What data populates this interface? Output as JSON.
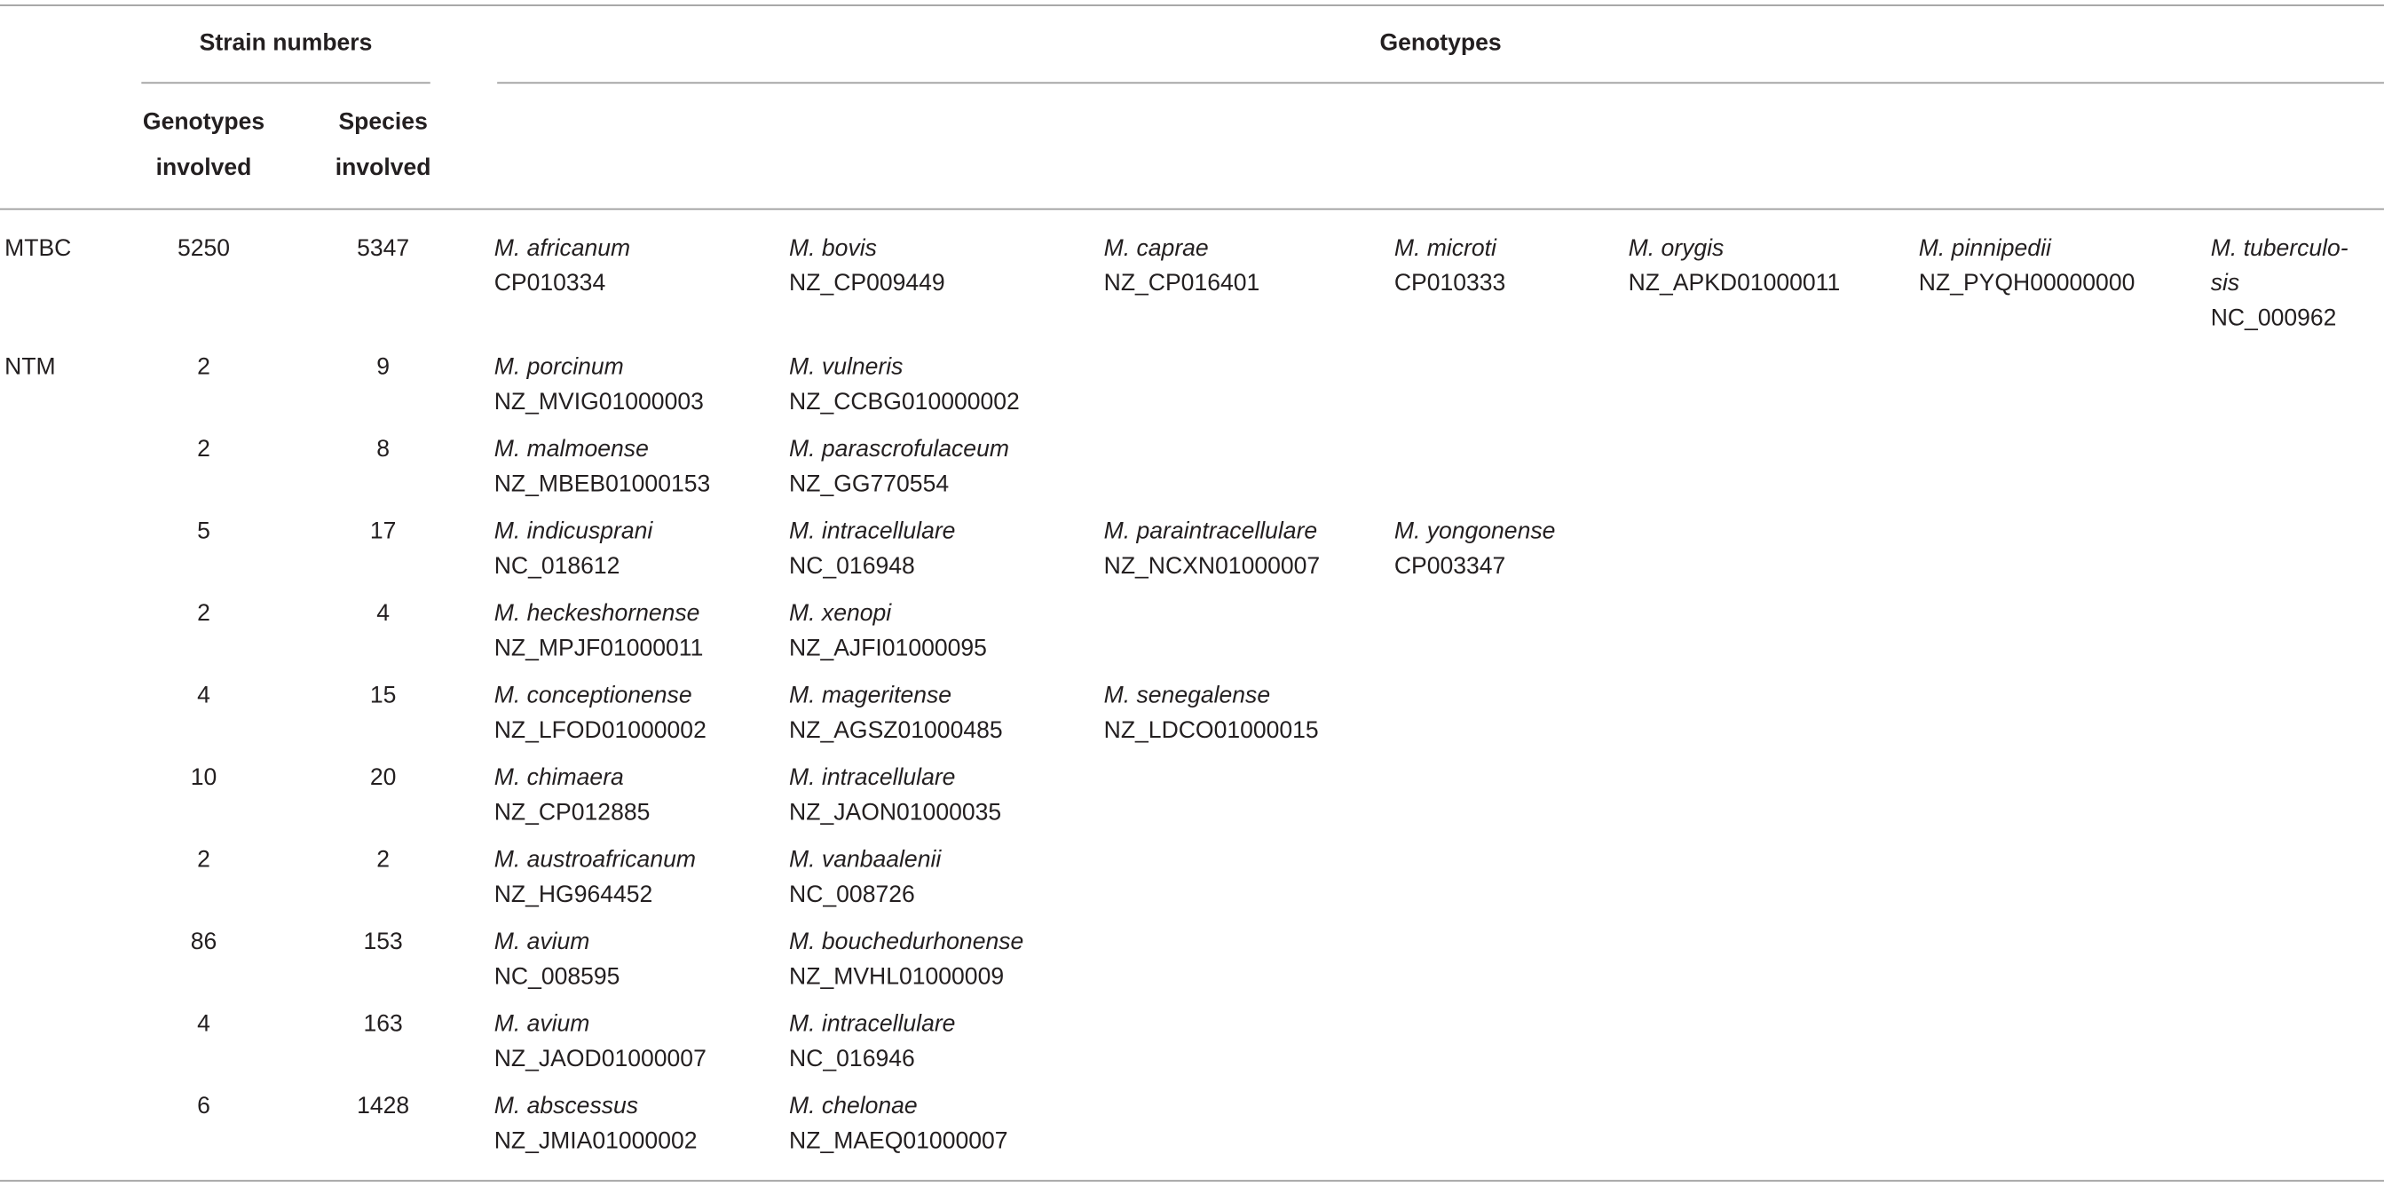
{
  "header": {
    "strain_numbers": "Strain numbers",
    "genotypes": "Genotypes",
    "genotypes_involved_line1": "Genotypes",
    "genotypes_involved_line2": "involved",
    "species_involved_line1": "Species",
    "species_involved_line2": "involved"
  },
  "rows": [
    {
      "group": "MTBC",
      "genotypes_involved": "5250",
      "species_involved": "5347",
      "entries": [
        {
          "species": "M. africanum",
          "accession": "CP010334"
        },
        {
          "species": "M. bovis",
          "accession": "NZ_CP009449"
        },
        {
          "species": "M. caprae",
          "accession": "NZ_CP016401"
        },
        {
          "species": "M. microti",
          "accession": "CP010333"
        },
        {
          "species": "M. orygis",
          "accession": "NZ_APKD01000011"
        },
        {
          "species": "M. pinnipedii",
          "accession": "NZ_PYQH00000000"
        },
        {
          "species": "M. tuberculo-",
          "species_cont": "sis",
          "accession": "NC_000962"
        }
      ]
    },
    {
      "group": "NTM",
      "genotypes_involved": "2",
      "species_involved": "9",
      "entries": [
        {
          "species": "M. porcinum",
          "accession": "NZ_MVIG01000003"
        },
        {
          "species": "M. vulneris",
          "accession": "NZ_CCBG010000002"
        }
      ]
    },
    {
      "group": "",
      "genotypes_involved": "2",
      "species_involved": "8",
      "entries": [
        {
          "species": "M. malmoense",
          "accession": "NZ_MBEB01000153"
        },
        {
          "species": "M. parascrofulaceum",
          "accession": "NZ_GG770554"
        }
      ]
    },
    {
      "group": "",
      "genotypes_involved": "5",
      "species_involved": "17",
      "entries": [
        {
          "species": "M. indicusprani",
          "accession": "NC_018612"
        },
        {
          "species": "M. intracellulare",
          "accession": "NC_016948"
        },
        {
          "species": "M. paraintracellulare",
          "accession": "NZ_NCXN01000007"
        },
        {
          "species": "M. yongonense",
          "accession": "CP003347"
        }
      ]
    },
    {
      "group": "",
      "genotypes_involved": "2",
      "species_involved": "4",
      "entries": [
        {
          "species": "M. heckeshornense",
          "accession": "NZ_MPJF01000011"
        },
        {
          "species": "M. xenopi",
          "accession": "NZ_AJFI01000095"
        }
      ]
    },
    {
      "group": "",
      "genotypes_involved": "4",
      "species_involved": "15",
      "entries": [
        {
          "species": "M. conceptionense",
          "accession": "NZ_LFOD01000002"
        },
        {
          "species": "M. mageritense",
          "accession": "NZ_AGSZ01000485"
        },
        {
          "species": "M. senegalense",
          "accession": "NZ_LDCO01000015"
        }
      ]
    },
    {
      "group": "",
      "genotypes_involved": "10",
      "species_involved": "20",
      "entries": [
        {
          "species": "M. chimaera",
          "accession": "NZ_CP012885"
        },
        {
          "species": "M. intracellulare",
          "accession": "NZ_JAON01000035"
        }
      ]
    },
    {
      "group": "",
      "genotypes_involved": "2",
      "species_involved": "2",
      "entries": [
        {
          "species": "M. austroafricanum",
          "accession": "NZ_HG964452"
        },
        {
          "species": "M. vanbaalenii",
          "accession": "NC_008726"
        }
      ]
    },
    {
      "group": "",
      "genotypes_involved": "86",
      "species_involved": "153",
      "entries": [
        {
          "species": "M. avium",
          "accession": "NC_008595"
        },
        {
          "species": "M. bouchedurhonense",
          "accession": "NZ_MVHL01000009"
        }
      ]
    },
    {
      "group": "",
      "genotypes_involved": "4",
      "species_involved": "163",
      "entries": [
        {
          "species": "M. avium",
          "accession": "NZ_JAOD01000007"
        },
        {
          "species": "M. intracellulare",
          "accession": "NC_016946"
        }
      ]
    },
    {
      "group": "",
      "genotypes_involved": "6",
      "species_involved": "1428",
      "entries": [
        {
          "species": "M. abscessus",
          "accession": "NZ_JMIA01000002"
        },
        {
          "species": "M. chelonae",
          "accession": "NZ_MAEQ01000007"
        }
      ]
    }
  ]
}
